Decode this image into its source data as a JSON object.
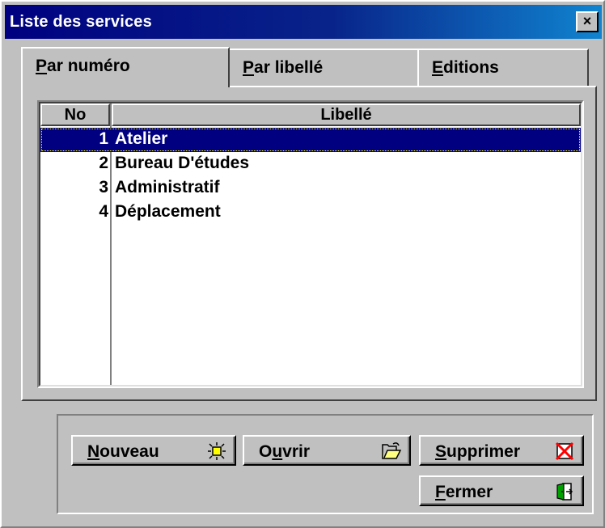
{
  "window": {
    "title": "Liste des services",
    "close_glyph": "×"
  },
  "tabs": [
    {
      "mnemonic": "P",
      "rest": "ar numéro",
      "active": true
    },
    {
      "mnemonic": "P",
      "rest": "ar libellé",
      "active": false
    },
    {
      "mnemonic": "E",
      "rest": "ditions",
      "active": false
    }
  ],
  "table": {
    "columns": [
      "No",
      "Libellé"
    ],
    "rows": [
      {
        "no": "1",
        "libelle": "Atelier",
        "selected": true
      },
      {
        "no": "2",
        "libelle": "Bureau D'études",
        "selected": false
      },
      {
        "no": "3",
        "libelle": "Administratif",
        "selected": false
      },
      {
        "no": "4",
        "libelle": "Déplacement",
        "selected": false
      }
    ]
  },
  "buttons": {
    "nouveau": {
      "pre": "",
      "mnemonic": "N",
      "rest": "ouveau",
      "icon": "lightbulb-icon"
    },
    "ouvrir": {
      "pre": "O",
      "mnemonic": "u",
      "rest": "vrir",
      "icon": "open-folder-icon"
    },
    "supprimer": {
      "pre": "",
      "mnemonic": "S",
      "rest": "upprimer",
      "icon": "delete-icon"
    },
    "fermer": {
      "pre": "",
      "mnemonic": "F",
      "rest": "ermer",
      "icon": "exit-door-icon"
    }
  },
  "colors": {
    "title_bar": "#000080",
    "selection": "#000080",
    "face": "#c0c0c0"
  }
}
